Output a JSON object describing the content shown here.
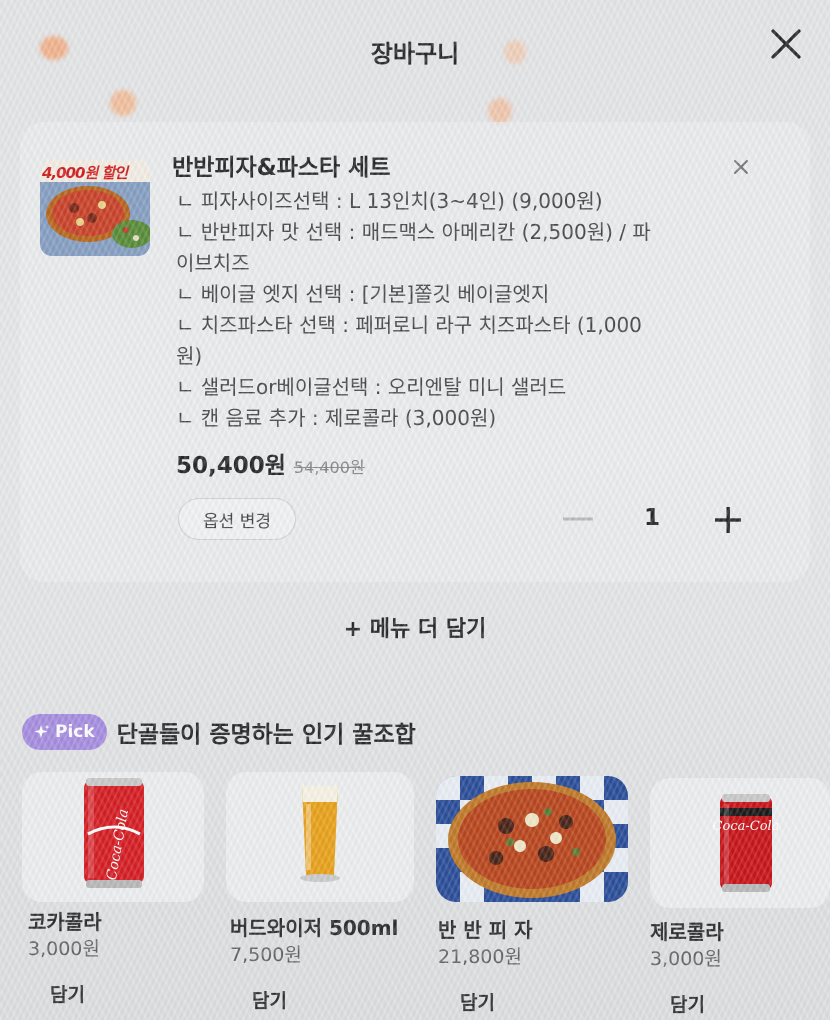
{
  "header": {
    "title": "장바구니"
  },
  "cart_item": {
    "badge": "4,000원 할인",
    "name": "반반피자&파스타 세트",
    "options": [
      "ㄴ 피자사이즈선택 : L 13인치(3~4인) (9,000원)",
      "ㄴ 반반피자 맛 선택 : 매드맥스 아메리칸 (2,500원) / 파",
      "이브치즈",
      "ㄴ 베이글 엣지 선택 : [기본]쫄깃 베이글엣지",
      "ㄴ 치즈파스타 선택 : 페퍼로니 라구 치즈파스타  (1,000",
      "원)",
      "ㄴ 샐러드or베이글선택 : 오리엔탈 미니 샐러드",
      "ㄴ 캔 음료 추가 : 제로콜라 (3,000원)"
    ],
    "price": "50,400원",
    "original_price": "54,400원",
    "option_change_label": "옵션 변경",
    "quantity": "1"
  },
  "more_menu": {
    "label": "+ 메뉴 더 담기"
  },
  "recommend": {
    "badge": "Pick",
    "title": "단골들이 증명하는 인기 꿀조합",
    "items": [
      {
        "name": "코카콜라",
        "price": "3,000원",
        "add_label": "담기",
        "icon": "coca-cola-can"
      },
      {
        "name": "버드와이저 500ml",
        "price": "7,500원",
        "add_label": "담기",
        "icon": "beer-glass"
      },
      {
        "name": "반 반 피 자",
        "price": "21,800원",
        "add_label": "담기",
        "icon": "pizza"
      },
      {
        "name": "제로콜라",
        "price": "3,000원",
        "add_label": "담기",
        "icon": "zero-cola-can"
      }
    ]
  },
  "colors": {
    "accent": "#a78ee0",
    "text": "#2a2a2a",
    "discount_red": "#d22020"
  }
}
